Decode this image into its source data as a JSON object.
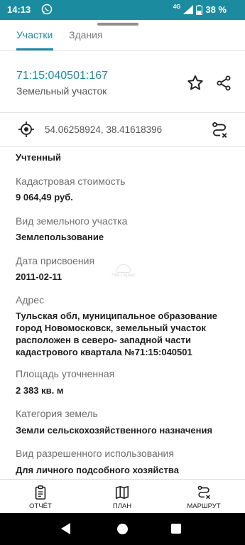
{
  "status_bar": {
    "time": "14:13",
    "network": "4G",
    "battery": "38 %",
    "whatsapp_icon": "whatsapp-icon",
    "signal_icon": "signal-icon",
    "battery_icon": "battery-icon"
  },
  "tabs": [
    {
      "label": "Участки",
      "active": true
    },
    {
      "label": "Здания",
      "active": false
    }
  ],
  "object": {
    "cadastral_number": "71:15:040501:167",
    "type": "Земельный участок"
  },
  "coordinates": {
    "text": "54.06258924, 38.41618396"
  },
  "status": "Учтенный",
  "fields": [
    {
      "label": "Кадастровая стоимость",
      "value": "9 064,49 руб."
    },
    {
      "label": "Вид земельного участка",
      "value": "Землепользование"
    },
    {
      "label": "Дата присвоения",
      "value": "2011-02-11"
    },
    {
      "label": "Адрес",
      "value": "Тульская обл, муниципальное образование город Новомосковск, земельный участок расположен в северо- западной части кадастрового квартала №71:15:040501"
    },
    {
      "label": "Площадь уточненная",
      "value": "2 383 кв. м"
    },
    {
      "label": "Категория земель",
      "value": "Земли сельскохозяйственного назначения"
    },
    {
      "label": "Вид разрешенного использования",
      "value": "Для личного подсобного хозяйства"
    }
  ],
  "watermark": "ПКК.Сервис",
  "bottom_nav": [
    {
      "label": "ОТЧЁТ",
      "icon": "report-icon"
    },
    {
      "label": "ПЛАН",
      "icon": "map-icon"
    },
    {
      "label": "МАРШРУТ",
      "icon": "route-icon"
    }
  ],
  "colors": {
    "accent": "#1b8ca0",
    "status_bar": "#1b8ca0",
    "text_primary": "#212121",
    "text_secondary": "#6e6e6e"
  }
}
